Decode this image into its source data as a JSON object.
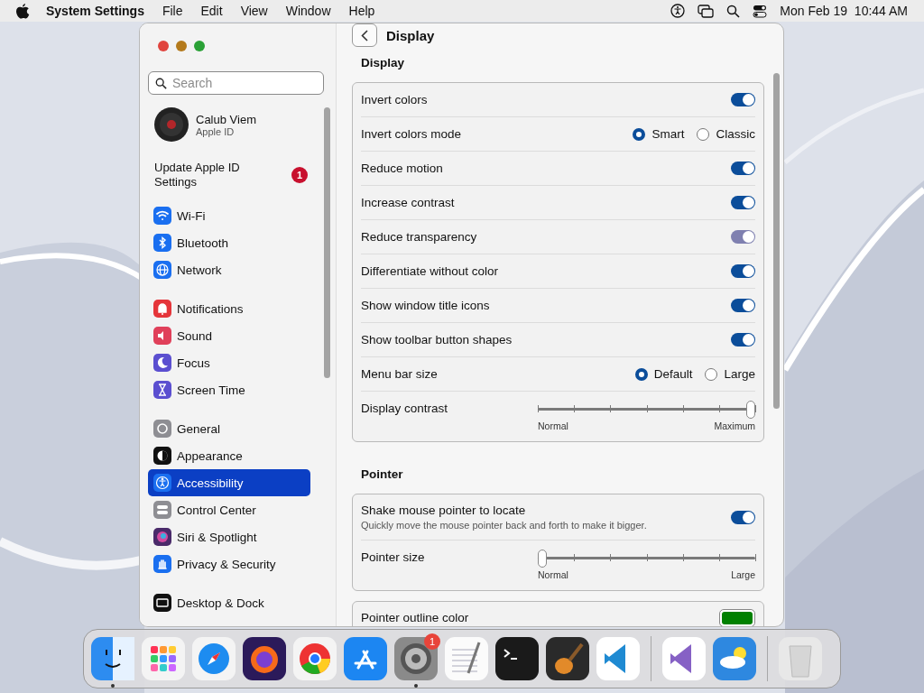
{
  "menu_bar": {
    "app_name": "System Settings",
    "menus": [
      "File",
      "Edit",
      "View",
      "Window",
      "Help"
    ],
    "clock": "Mon Feb 19  10:44 AM"
  },
  "sidebar": {
    "search": {
      "placeholder": "Search"
    },
    "account": {
      "name": "Calub Viem",
      "subtitle": "Apple ID"
    },
    "update": {
      "label": "Update Apple ID Settings",
      "badge": "1"
    },
    "groups": [
      [
        {
          "label": "Wi-Fi",
          "kind": "wifi",
          "selected": false
        },
        {
          "label": "Bluetooth",
          "kind": "bluetooth",
          "selected": false
        },
        {
          "label": "Network",
          "kind": "network",
          "selected": false
        }
      ],
      [
        {
          "label": "Notifications",
          "kind": "notifications",
          "selected": false
        },
        {
          "label": "Sound",
          "kind": "sound",
          "selected": false
        },
        {
          "label": "Focus",
          "kind": "focus",
          "selected": false
        },
        {
          "label": "Screen Time",
          "kind": "screentime",
          "selected": false
        }
      ],
      [
        {
          "label": "General",
          "kind": "general",
          "selected": false
        },
        {
          "label": "Appearance",
          "kind": "appearance",
          "selected": false
        },
        {
          "label": "Accessibility",
          "kind": "accessibility",
          "selected": true
        },
        {
          "label": "Control Center",
          "kind": "controlcenter",
          "selected": false
        },
        {
          "label": "Siri & Spotlight",
          "kind": "siri",
          "selected": false
        },
        {
          "label": "Privacy & Security",
          "kind": "privacy",
          "selected": false
        }
      ],
      [
        {
          "label": "Desktop & Dock",
          "kind": "desktop",
          "selected": false
        }
      ]
    ]
  },
  "content": {
    "title": "Display",
    "sections": [
      {
        "title": "Display",
        "rows": [
          {
            "kind": "toggle",
            "label": "Invert colors",
            "on": true,
            "disabled": false
          },
          {
            "kind": "radio",
            "label": "Invert colors mode",
            "options": [
              {
                "label": "Smart",
                "selected": true
              },
              {
                "label": "Classic",
                "selected": false
              }
            ]
          },
          {
            "kind": "toggle",
            "label": "Reduce motion",
            "on": true,
            "disabled": false
          },
          {
            "kind": "toggle",
            "label": "Increase contrast",
            "on": true,
            "disabled": false
          },
          {
            "kind": "toggle",
            "label": "Reduce transparency",
            "on": true,
            "disabled": true
          },
          {
            "kind": "toggle",
            "label": "Differentiate without color",
            "on": true,
            "disabled": false
          },
          {
            "kind": "toggle",
            "label": "Show window title icons",
            "on": true,
            "disabled": false
          },
          {
            "kind": "toggle",
            "label": "Show toolbar button shapes",
            "on": true,
            "disabled": false
          },
          {
            "kind": "radio",
            "label": "Menu bar size",
            "options": [
              {
                "label": "Default",
                "selected": true
              },
              {
                "label": "Large",
                "selected": false
              }
            ]
          },
          {
            "kind": "slider",
            "label": "Display contrast",
            "level": 1,
            "min_label": "Normal",
            "max_label": "Maximum"
          }
        ]
      },
      {
        "title": "Pointer",
        "rows": [
          {
            "kind": "toggle",
            "label": "Shake mouse pointer to locate",
            "description": "Quickly move the mouse pointer back and forth to make it bigger.",
            "on": true,
            "disabled": false
          },
          {
            "kind": "slider",
            "label": "Pointer size",
            "level": 0,
            "min_label": "Normal",
            "max_label": "Large"
          }
        ]
      },
      {
        "rows": [
          {
            "kind": "color",
            "label": "Pointer outline color",
            "color": "#008000"
          }
        ]
      }
    ]
  },
  "dock": [
    {
      "kind": "finder",
      "running": true
    },
    {
      "kind": "launchpad",
      "running": false
    },
    {
      "kind": "safari",
      "running": false
    },
    {
      "kind": "firefox",
      "running": false
    },
    {
      "kind": "chrome",
      "running": false
    },
    {
      "kind": "appstore",
      "running": false
    },
    {
      "kind": "settings",
      "running": true,
      "badge": "1"
    },
    {
      "kind": "textedit",
      "running": false
    },
    {
      "kind": "terminal",
      "running": false
    },
    {
      "kind": "garageband",
      "running": false
    },
    {
      "kind": "vscode",
      "running": false
    },
    {
      "kind": "separator"
    },
    {
      "kind": "visualstudio",
      "running": false
    },
    {
      "kind": "weather",
      "running": false
    },
    {
      "kind": "separator"
    },
    {
      "kind": "trash",
      "running": false
    }
  ]
}
